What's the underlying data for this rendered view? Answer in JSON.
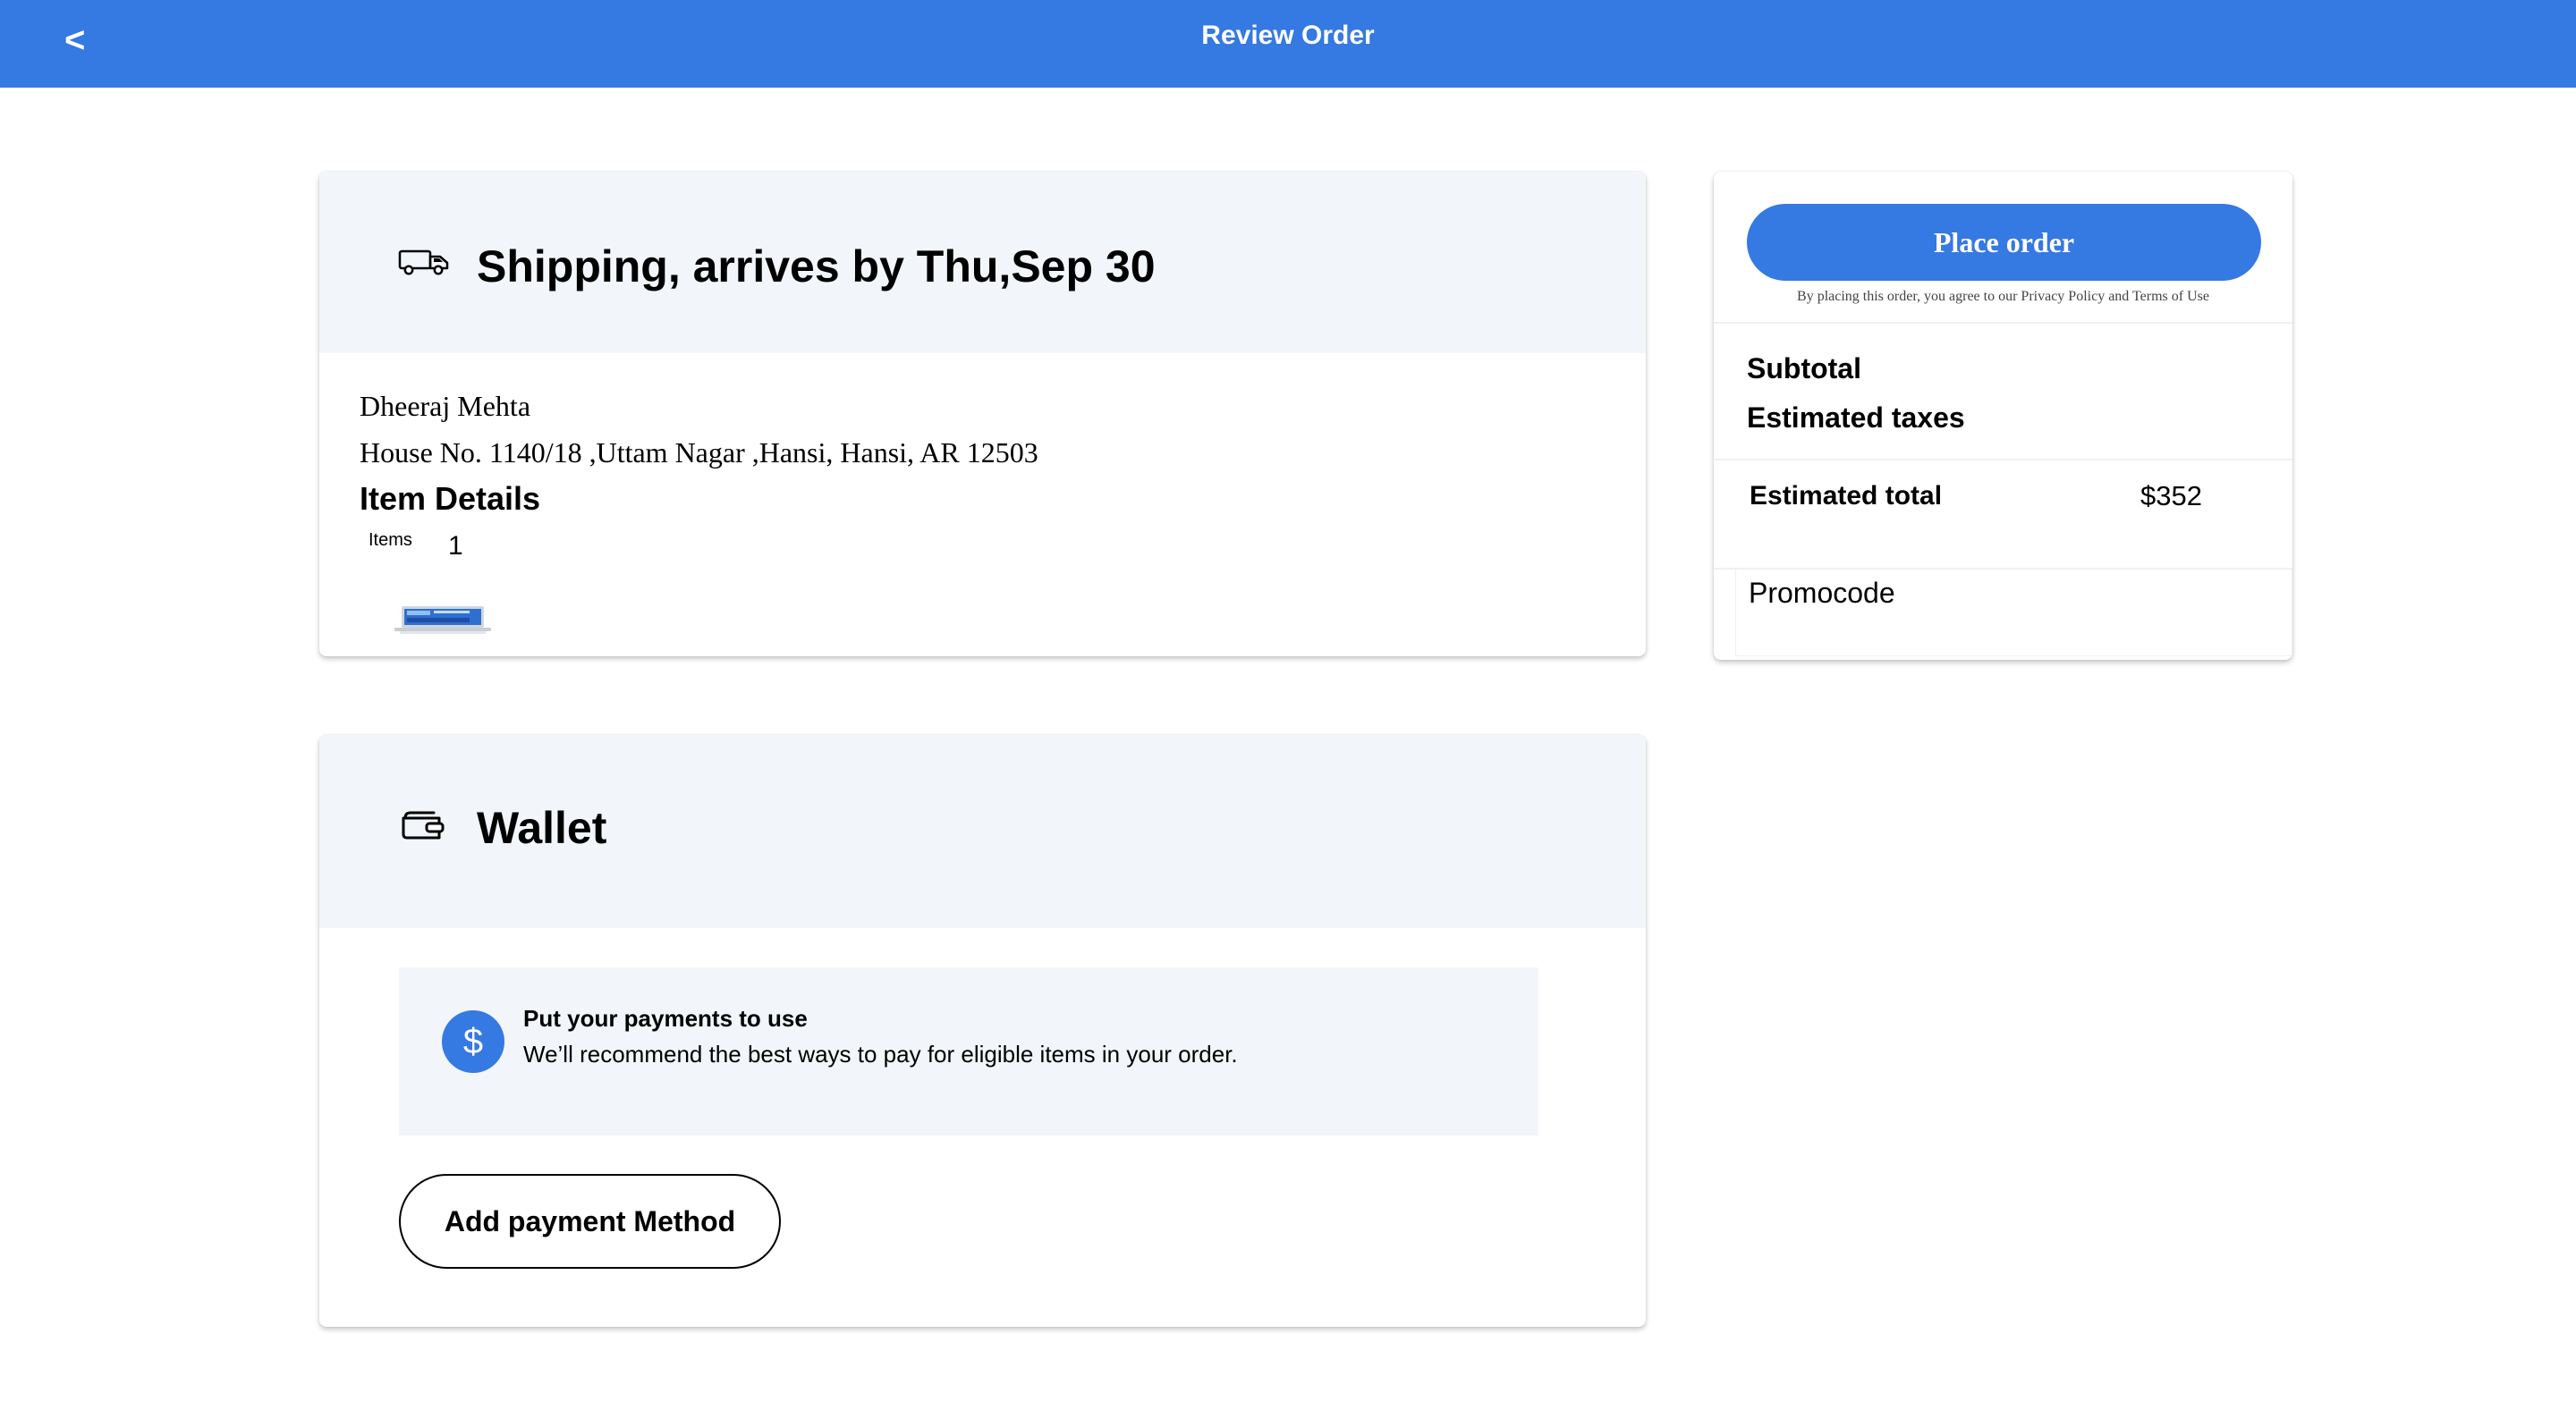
{
  "header": {
    "title": "Review Order",
    "back_label": "<",
    "back_icon": "chevron-left-icon",
    "background": "#3579e2"
  },
  "shipping": {
    "title": "Shipping, arrives by Thu,Sep 30",
    "icon": "truck-icon",
    "recipient": "Dheeraj Mehta",
    "address": "House No. 1140/18 ,Uttam Nagar ,Hansi, Hansi, AR 12503",
    "item_details_heading": "Item Details",
    "items_label": "Items",
    "items_count": "1",
    "item_thumbnail": "laptop-thumbnail"
  },
  "wallet": {
    "title": "Wallet",
    "icon": "wallet-icon",
    "info_icon": "dollar-icon",
    "info_icon_glyph": "$",
    "info_title": "Put your payments to use",
    "info_desc": "We’ll recommend the best ways to pay for eligible items in your order.",
    "add_payment_label": "Add payment Method"
  },
  "summary": {
    "place_order_label": "Place order",
    "disclaimer": "By placing this order, you agree to our Privacy Policy and Terms of Use",
    "subtotal_label": "Subtotal",
    "taxes_label": "Estimated taxes",
    "total_label": "Estimated total",
    "total_value": "$352",
    "promo_label": "Promocode"
  },
  "colors": {
    "accent": "#3579e2",
    "panel_bg": "#f2f6fa"
  }
}
